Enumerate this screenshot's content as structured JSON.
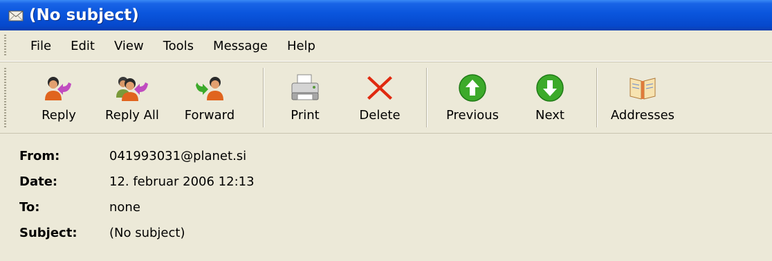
{
  "window": {
    "title": "(No subject)",
    "title_icon": "envelope-icon"
  },
  "menu": [
    "File",
    "Edit",
    "View",
    "Tools",
    "Message",
    "Help"
  ],
  "toolbar": {
    "reply": {
      "label": "Reply",
      "icon": "reply-icon"
    },
    "reply_all": {
      "label": "Reply All",
      "icon": "reply-all-icon"
    },
    "forward": {
      "label": "Forward",
      "icon": "forward-icon"
    },
    "print": {
      "label": "Print",
      "icon": "printer-icon"
    },
    "delete": {
      "label": "Delete",
      "icon": "delete-x-icon"
    },
    "previous": {
      "label": "Previous",
      "icon": "arrow-up-icon"
    },
    "next": {
      "label": "Next",
      "icon": "arrow-down-icon"
    },
    "addresses": {
      "label": "Addresses",
      "icon": "address-book-icon"
    }
  },
  "headers": {
    "from": {
      "label": "From:",
      "value": "041993031@planet.si"
    },
    "date": {
      "label": "Date:",
      "value": "12. februar 2006 12:13"
    },
    "to": {
      "label": "To:",
      "value": "none"
    },
    "subject": {
      "label": "Subject:",
      "value": "(No subject)"
    }
  },
  "colors": {
    "title_bar": "#0A55DC",
    "face": "#ECE9D8",
    "delete_red": "#E02A10",
    "nav_green": "#3CAA2A",
    "reply_arrow": "#C04CC0"
  }
}
